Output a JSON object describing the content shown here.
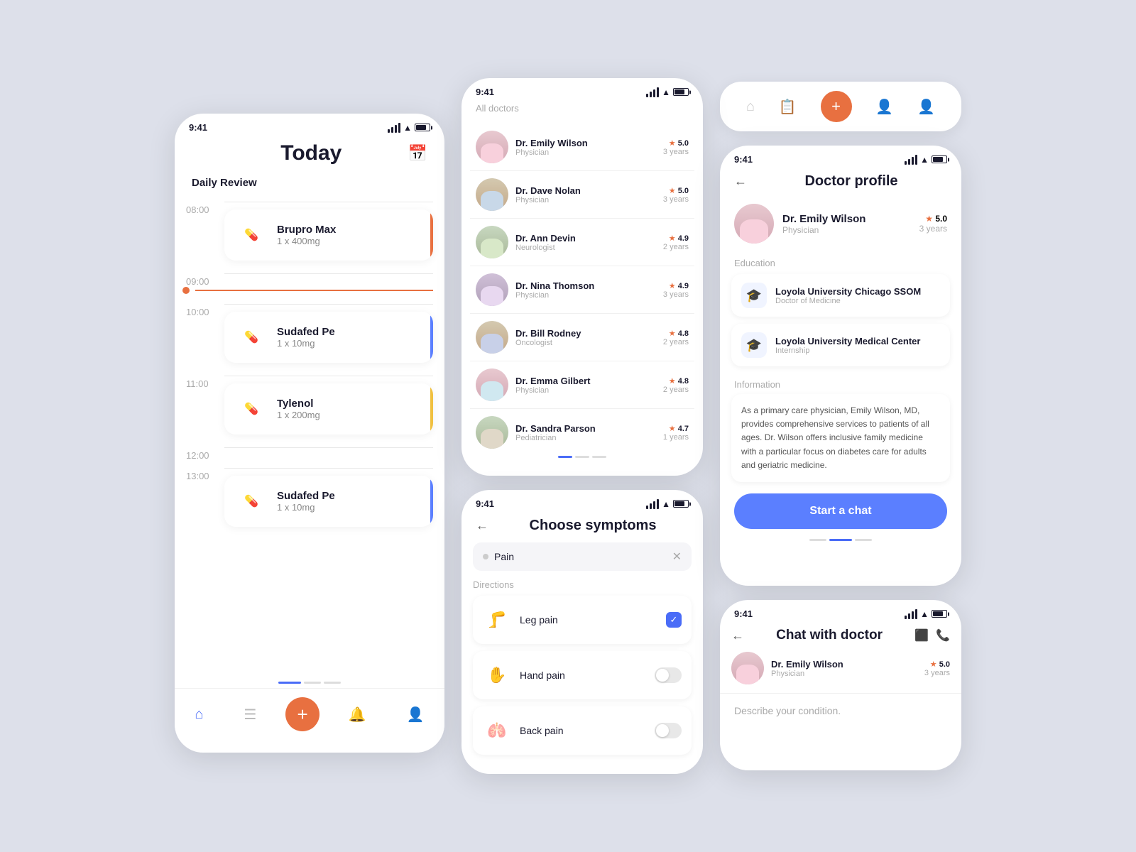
{
  "app": {
    "bg_color": "#dde0ea"
  },
  "screen1": {
    "status_time": "9:41",
    "title": "Today",
    "section": "Daily Review",
    "times": [
      "08:00",
      "09:00",
      "10:00",
      "11:00",
      "12:00",
      "13:00"
    ],
    "medications": [
      {
        "name": "Brupro Max",
        "dose": "1 x 400mg",
        "color": "#e87040",
        "time": "08:00"
      },
      {
        "name": "Sudafed Pe",
        "dose": "1 x 10mg",
        "color": "#5b7fff",
        "time": "10:00"
      },
      {
        "name": "Tylenol",
        "dose": "1 x 200mg",
        "color": "#f0c040",
        "time": "11:00"
      },
      {
        "name": "Sudafed Pe",
        "dose": "1 x 10mg",
        "color": "#5b7fff",
        "time": "13:00"
      }
    ],
    "nav": [
      "home",
      "list",
      "plus",
      "bell",
      "person"
    ]
  },
  "screen2": {
    "status_time": "9:41",
    "section_label": "All doctors",
    "doctors": [
      {
        "name": "Dr. Emily Wilson",
        "specialty": "Physician",
        "rating": "5.0",
        "years": "3 years"
      },
      {
        "name": "Dr. Dave Nolan",
        "specialty": "Physician",
        "rating": "5.0",
        "years": "3 years"
      },
      {
        "name": "Dr. Ann Devin",
        "specialty": "Neurologist",
        "rating": "4.9",
        "years": "2 years"
      },
      {
        "name": "Dr. Nina Thomson",
        "specialty": "Physician",
        "rating": "4.9",
        "years": "3 years"
      },
      {
        "name": "Dr. Bill Rodney",
        "specialty": "Oncologist",
        "rating": "4.8",
        "years": "2 years"
      },
      {
        "name": "Dr. Emma Gilbert",
        "specialty": "Physician",
        "rating": "4.8",
        "years": "2 years"
      },
      {
        "name": "Dr. Sandra Parson",
        "specialty": "Pediatrician",
        "rating": "4.7",
        "years": "1 years"
      }
    ]
  },
  "screen3": {
    "status_time": "9:41",
    "title": "Choose symptoms",
    "search_value": "Pain",
    "directions_label": "Directions",
    "symptoms": [
      {
        "name": "Leg pain",
        "checked": true,
        "icon": "🦵"
      },
      {
        "name": "Hand pain",
        "checked": false,
        "icon": "✋"
      },
      {
        "name": "Back pain",
        "checked": false,
        "icon": "🫁"
      }
    ]
  },
  "screen4": {
    "status_time": "9:41",
    "title": "Doctor profile",
    "doctor": {
      "name": "Dr. Emily Wilson",
      "specialty": "Physician",
      "rating": "5.0",
      "years": "3 years"
    },
    "education_label": "Education",
    "education": [
      {
        "school": "Loyola University Chicago SSOM",
        "degree": "Doctor of Medicine"
      },
      {
        "school": "Loyola University Medical Center",
        "degree": "Internship"
      }
    ],
    "info_label": "Information",
    "info_text": "As a primary care physician, Emily Wilson, MD, provides comprehensive services to patients of all ages. Dr. Wilson offers inclusive family medicine with a particular focus on diabetes care for adults and geriatric medicine.",
    "cta": "Start a chat"
  },
  "screen5": {
    "status_time": "9:41",
    "title": "Chat with doctor",
    "doctor": {
      "name": "Dr. Emily Wilson",
      "specialty": "Physician",
      "rating": "5.0",
      "years": "3 years"
    },
    "placeholder": "Describe your condition."
  },
  "topnav": {
    "icons": [
      "home",
      "clipboard",
      "plus",
      "person-outline",
      "person"
    ]
  }
}
